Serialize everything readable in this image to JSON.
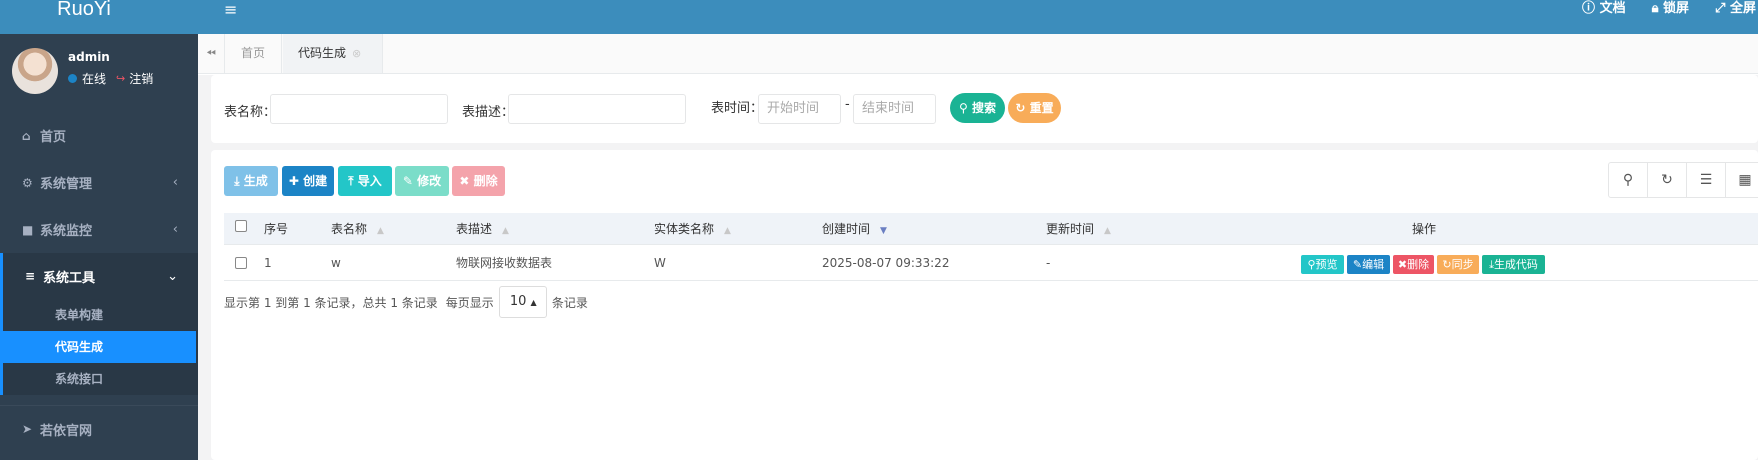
{
  "brand": "RuoYi",
  "user": {
    "name": "admin",
    "status": "在线",
    "logout": "注销"
  },
  "sidebar": {
    "items": [
      {
        "icon": "home-icon",
        "label": "首页"
      },
      {
        "icon": "gear-icon",
        "label": "系统管理"
      },
      {
        "icon": "video-icon",
        "label": "系统监控"
      },
      {
        "icon": "bars-icon",
        "label": "系统工具"
      },
      {
        "icon": "send-icon",
        "label": "若依官网"
      }
    ],
    "tools_sub": [
      {
        "label": "表单构建"
      },
      {
        "label": "代码生成"
      },
      {
        "label": "系统接口"
      }
    ]
  },
  "topbar": {
    "docs": "文档",
    "lock": "锁屏",
    "fullscreen": "全屏"
  },
  "tabs": {
    "home": "首页",
    "active": "代码生成"
  },
  "search": {
    "table_name_label": "表名称：",
    "table_desc_label": "表描述：",
    "time_label": "表时间：",
    "start_placeholder": "开始时间",
    "end_placeholder": "结束时间",
    "dash": "-",
    "search_button": "搜索",
    "reset_button": "重置"
  },
  "toolbar": {
    "generate": "生成",
    "create": "创建",
    "import": "导入",
    "edit": "修改",
    "delete": "删除"
  },
  "table": {
    "columns": [
      "序号",
      "表名称",
      "表描述",
      "实体类名称",
      "创建时间",
      "更新时间",
      "操作"
    ],
    "rows": [
      {
        "index": "1",
        "table_name": "w",
        "table_desc": "物联网接收数据表",
        "class_name": "W",
        "create_time": "2025-08-07 09:33:22",
        "update_time": "-"
      }
    ],
    "row_actions": {
      "preview": "预览",
      "edit": "编辑",
      "delete": "删除",
      "sync": "同步",
      "gencode": "生成代码"
    }
  },
  "pagination": {
    "summary": "显示第 1 到第 1 条记录，总共 1 条记录",
    "per_page_prefix": "每页显示",
    "page_size": "10",
    "per_page_suffix": "条记录"
  },
  "colors": {
    "topbar": "#3c8dbc",
    "sidebar": "#2f4050",
    "active_menu": "#1890ff",
    "search_btn": "#1ab394",
    "reset_btn": "#f8ac59",
    "danger": "#ed5565",
    "info": "#23c6c8",
    "primary": "#1c84c6"
  }
}
